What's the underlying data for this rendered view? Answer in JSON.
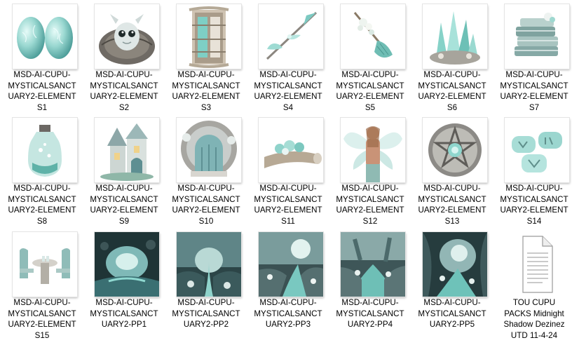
{
  "files": [
    {
      "lines": [
        "MSD-AI-CUPU-",
        "MYSTICALSANCT",
        "UARY2-ELEMENT",
        "S1"
      ],
      "icon": "eggs-icon"
    },
    {
      "lines": [
        "MSD-AI-CUPU-",
        "MYSTICALSANCT",
        "UARY2-ELEMENT",
        "S2"
      ],
      "icon": "dragon-nest-icon"
    },
    {
      "lines": [
        "MSD-AI-CUPU-",
        "MYSTICALSANCT",
        "UARY2-ELEMENT",
        "S3"
      ],
      "icon": "cabinet-icon"
    },
    {
      "lines": [
        "MSD-AI-CUPU-",
        "MYSTICALSANCT",
        "UARY2-ELEMENT",
        "S4"
      ],
      "icon": "spear-icon"
    },
    {
      "lines": [
        "MSD-AI-CUPU-",
        "MYSTICALSANCT",
        "UARY2-ELEMENT",
        "S5"
      ],
      "icon": "broom-icon"
    },
    {
      "lines": [
        "MSD-AI-CUPU-",
        "MYSTICALSANCT",
        "UARY2-ELEMENT",
        "S6"
      ],
      "icon": "crystals-icon"
    },
    {
      "lines": [
        "MSD-AI-CUPU-",
        "MYSTICALSANCT",
        "UARY2-ELEMENT",
        "S7"
      ],
      "icon": "books-icon"
    },
    {
      "lines": [
        "MSD-AI-CUPU-",
        "MYSTICALSANCT",
        "UARY2-ELEMENT",
        "S8"
      ],
      "icon": "jar-icon"
    },
    {
      "lines": [
        "MSD-AI-CUPU-",
        "MYSTICALSANCT",
        "UARY2-ELEMENT",
        "S9"
      ],
      "icon": "fairy-house-icon"
    },
    {
      "lines": [
        "MSD-AI-CUPU-",
        "MYSTICALSANCT",
        "UARY2-ELEMENT",
        "S10"
      ],
      "icon": "round-door-icon"
    },
    {
      "lines": [
        "MSD-AI-CUPU-",
        "MYSTICALSANCT",
        "UARY2-ELEMENT",
        "S11"
      ],
      "icon": "log-icon"
    },
    {
      "lines": [
        "MSD-AI-CUPU-",
        "MYSTICALSANCT",
        "UARY2-ELEMENT",
        "S12"
      ],
      "icon": "fairy-man-icon"
    },
    {
      "lines": [
        "MSD-AI-CUPU-",
        "MYSTICALSANCT",
        "UARY2-ELEMENT",
        "S13"
      ],
      "icon": "pentacle-icon"
    },
    {
      "lines": [
        "MSD-AI-CUPU-",
        "MYSTICALSANCT",
        "UARY2-ELEMENT",
        "S14"
      ],
      "icon": "rune-stones-icon"
    },
    {
      "lines": [
        "MSD-AI-CUPU-",
        "MYSTICALSANCT",
        "UARY2-ELEMENT",
        "S15"
      ],
      "icon": "table-chairs-icon"
    },
    {
      "lines": [
        "MSD-AI-CUPU-",
        "MYSTICALSANCT",
        "UARY2-PP1"
      ],
      "icon": "cave-paper-icon"
    },
    {
      "lines": [
        "MSD-AI-CUPU-",
        "MYSTICALSANCT",
        "UARY2-PP2"
      ],
      "icon": "forest-paper-icon"
    },
    {
      "lines": [
        "MSD-AI-CUPU-",
        "MYSTICALSANCT",
        "UARY2-PP3"
      ],
      "icon": "stream-paper-icon"
    },
    {
      "lines": [
        "MSD-AI-CUPU-",
        "MYSTICALSANCT",
        "UARY2-PP4"
      ],
      "icon": "river-paper-icon"
    },
    {
      "lines": [
        "MSD-AI-CUPU-",
        "MYSTICALSANCT",
        "UARY2-PP5"
      ],
      "icon": "grotto-paper-icon"
    },
    {
      "lines": [
        "TOU CUPU",
        "PACKS Midnight",
        "Shadow Dezinez",
        "UTD 11-4-24"
      ],
      "icon": "text-document-icon"
    }
  ],
  "colors": {
    "teal": "#8fd3cd",
    "teal_dark": "#3f8f8c",
    "stone": "#9a9a98",
    "wood": "#b8aa98"
  }
}
